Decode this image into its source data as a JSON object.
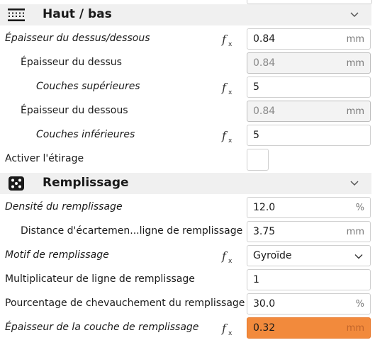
{
  "sections": {
    "top_bottom": {
      "title": "Haut / bas",
      "icon": "top-bottom-icon"
    },
    "infill": {
      "title": "Remplissage",
      "icon": "infill-icon"
    }
  },
  "rows": {
    "top_bottom_thickness": {
      "label": "Épaisseur du dessus/dessous",
      "value": "0.84",
      "unit": "mm"
    },
    "top_thickness": {
      "label": "Épaisseur du dessus",
      "value": "0.84",
      "unit": "mm"
    },
    "top_layers": {
      "label": "Couches supérieures",
      "value": "5"
    },
    "bottom_thickness": {
      "label": "Épaisseur du dessous",
      "value": "0.84",
      "unit": "mm"
    },
    "bottom_layers": {
      "label": "Couches inférieures",
      "value": "5"
    },
    "ironing": {
      "label": "Activer l'étirage",
      "checked": false
    },
    "infill_density": {
      "label": "Densité du remplissage",
      "value": "12.0",
      "unit": "%"
    },
    "infill_line_distance": {
      "label": "Distance d'écartemen...ligne de remplissage",
      "value": "3.75",
      "unit": "mm"
    },
    "infill_pattern": {
      "label": "Motif de remplissage",
      "value": "Gyroïde"
    },
    "infill_multiplier": {
      "label": "Multiplicateur de ligne de remplissage",
      "value": "1"
    },
    "infill_overlap": {
      "label": "Pourcentage de chevauchement du remplissage",
      "value": "30.0",
      "unit": "%"
    },
    "infill_layer_thickness": {
      "label": "Épaisseur de la couche de remplissage",
      "value": "0.32",
      "unit": "mm"
    }
  },
  "icons": {
    "function": "fx-icon",
    "collapse": "chevron-down-icon"
  },
  "colors": {
    "section_bg": "#f0f0f0",
    "error_field": "#f28a3c",
    "border": "#cfcfcf"
  }
}
